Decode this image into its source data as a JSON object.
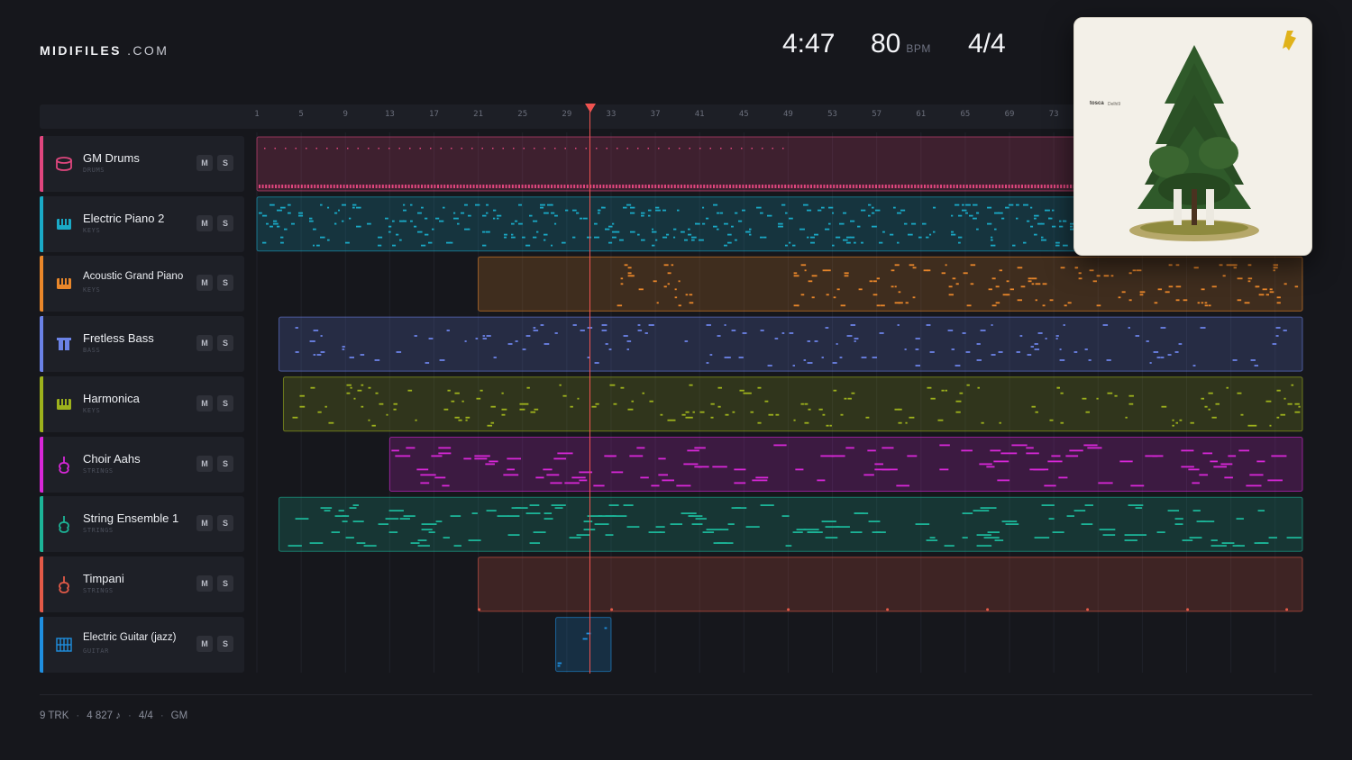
{
  "brand": {
    "name_bold": "MIDIFILES",
    "name_rest": ".COM"
  },
  "transport": {
    "time": "4:47",
    "bpm": "80",
    "bpm_unit": "BPM",
    "time_signature": "4/4"
  },
  "album": {
    "title": "tosca",
    "subtitle": "Delhi9"
  },
  "ruler": {
    "ticks": [
      "1",
      "5",
      "9",
      "13",
      "17",
      "21",
      "25",
      "29",
      "33",
      "37",
      "41",
      "45",
      "49",
      "53",
      "57",
      "61",
      "65",
      "69",
      "73"
    ]
  },
  "playhead": {
    "bar": 30.7
  },
  "tracks": [
    {
      "name": "GM Drums",
      "category": "DRUMS",
      "color": "#e0467e",
      "icon": "drum-icon",
      "mute": "M",
      "solo": "S"
    },
    {
      "name": "Electric Piano 2",
      "category": "KEYS",
      "color": "#1aa9c6",
      "icon": "keyboard-icon",
      "mute": "M",
      "solo": "S"
    },
    {
      "name": "Acoustic Grand Piano",
      "category": "KEYS",
      "color": "#e8862a",
      "icon": "keyboard-icon",
      "mute": "M",
      "solo": "S"
    },
    {
      "name": "Fretless Bass",
      "category": "BASS",
      "color": "#6b82e6",
      "icon": "bass-icon",
      "mute": "M",
      "solo": "S"
    },
    {
      "name": "Harmonica",
      "category": "KEYS",
      "color": "#9db11c",
      "icon": "keyboard-icon",
      "mute": "M",
      "solo": "S"
    },
    {
      "name": "Choir Aahs",
      "category": "STRINGS",
      "color": "#d827d8",
      "icon": "violin-icon",
      "mute": "M",
      "solo": "S"
    },
    {
      "name": "String Ensemble 1",
      "category": "STRINGS",
      "color": "#1cb497",
      "icon": "violin-icon",
      "mute": "M",
      "solo": "S"
    },
    {
      "name": "Timpani",
      "category": "STRINGS",
      "color": "#e35a48",
      "icon": "violin-icon",
      "mute": "M",
      "solo": "S"
    },
    {
      "name": "Electric Guitar (jazz)",
      "category": "GUITAR",
      "color": "#1f8fe0",
      "icon": "guitar-icon",
      "mute": "M",
      "solo": "S"
    }
  ],
  "footer": {
    "tracks": "9 TRK",
    "notes": "4 827 ♪",
    "signature": "4/4",
    "standard": "GM"
  }
}
